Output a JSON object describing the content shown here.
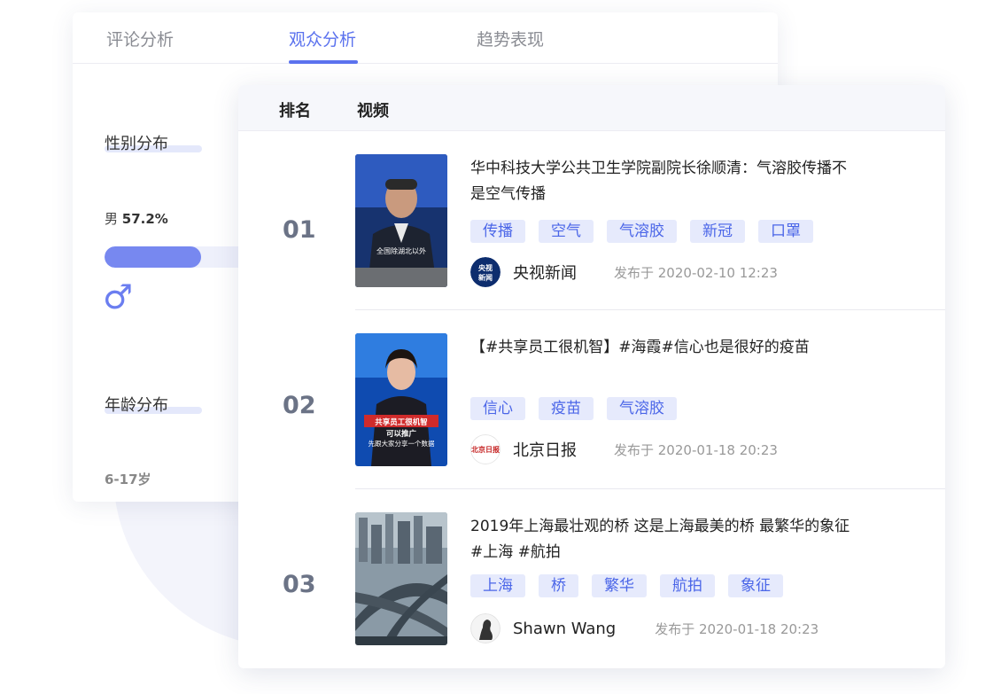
{
  "tabs": [
    {
      "label": "评论分析"
    },
    {
      "label": "观众分析"
    },
    {
      "label": "趋势表现"
    }
  ],
  "active_tab": "观众分析",
  "audience": {
    "gender_title": "性别分布",
    "male_label": "男",
    "male_percent_text": "57.2%",
    "male_fraction": 0.572,
    "male_symbol": "♂",
    "age_title": "年龄分布",
    "age_group_first": "6-17岁"
  },
  "table": {
    "headers": {
      "rank": "排名",
      "video": "视频"
    },
    "rows": [
      {
        "rank": "01",
        "title": "华中科技大学公共卫生学院副院长徐顺清：气溶胶传播不是空气传播",
        "tags": [
          "传播",
          "空气",
          "气溶胶",
          "新冠",
          "口罩"
        ],
        "author": "央视新闻",
        "published": "发布于 2020-02-10  12:23",
        "thumb_caption": "全国除湖北以外",
        "avatar_text": "央视新闻"
      },
      {
        "rank": "02",
        "title": "【#共享员工很机智】#海霞#信心也是很好的疫苗",
        "tags": [
          "信心",
          "疫苗",
          "气溶胶"
        ],
        "author": "北京日报",
        "published": "发布于 2020-01-18  20:23",
        "thumb_caption_lines": [
          "共享员工很机智",
          "可以推广",
          "先跟大家分享一个数据"
        ],
        "avatar_text": "北京日报"
      },
      {
        "rank": "03",
        "title": "2019年上海最壮观的桥 这是上海最美的桥 最繁华的象征 #上海 #航拍",
        "tags": [
          "上海",
          "桥",
          "繁华",
          "航拍",
          "象征"
        ],
        "author": "Shawn Wang",
        "published": "发布于 2020-01-18  20:23"
      }
    ]
  },
  "colors": {
    "accent": "#5b72ee",
    "tag_bg": "#e6eafc",
    "tag_text": "#4b66e8",
    "bar_fill": "#7788f0",
    "rank_text": "#6b7386"
  }
}
